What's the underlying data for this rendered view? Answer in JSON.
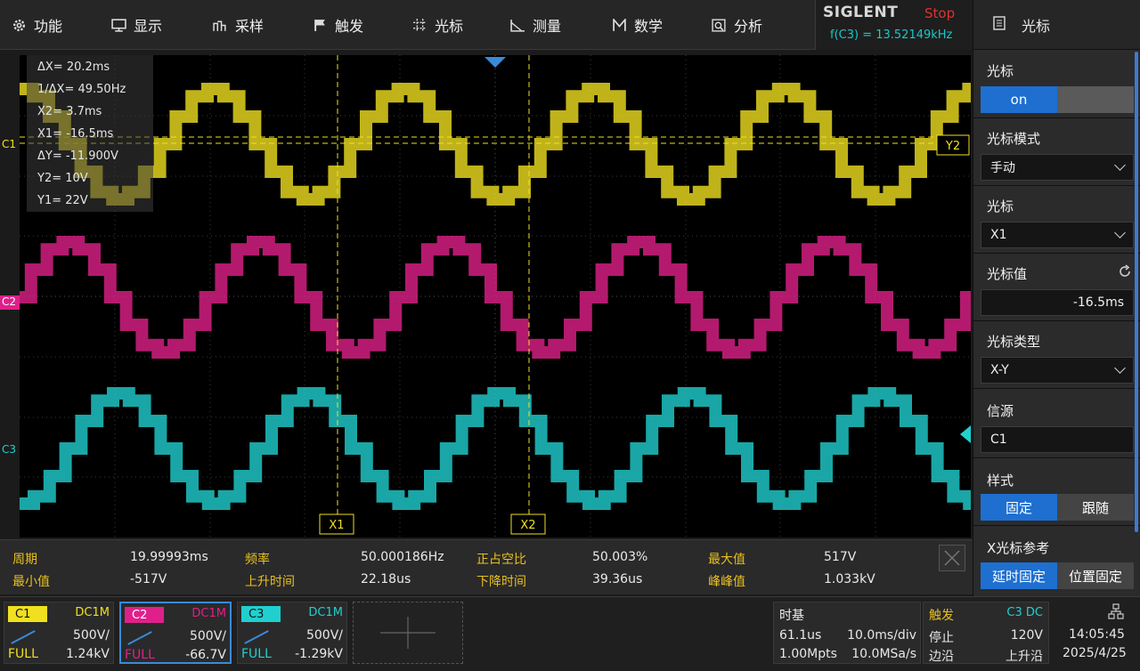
{
  "menu": [
    {
      "label": "功能",
      "icon": "gear-icon"
    },
    {
      "label": "显示",
      "icon": "monitor-icon"
    },
    {
      "label": "采样",
      "icon": "sample-icon"
    },
    {
      "label": "触发",
      "icon": "flag-icon"
    },
    {
      "label": "光标",
      "icon": "cursor-icon"
    },
    {
      "label": "测量",
      "icon": "ruler-icon"
    },
    {
      "label": "数学",
      "icon": "math-icon"
    },
    {
      "label": "分析",
      "icon": "analyze-icon"
    }
  ],
  "brand": {
    "logo": "SIGLENT",
    "status": "Stop",
    "freq": "f(C3) = 13.52149kHz"
  },
  "panel": {
    "title": "光标",
    "cursor_label": "光标",
    "cursor_on": "on",
    "mode_label": "光标模式",
    "mode_value": "手动",
    "cursor_sel_label": "光标",
    "cursor_sel_value": "X1",
    "value_label": "光标值",
    "value_value": "-16.5ms",
    "type_label": "光标类型",
    "type_value": "X-Y",
    "source_label": "信源",
    "source_value": "C1",
    "style_label": "样式",
    "style_a": "固定",
    "style_b": "跟随",
    "xref_label": "X光标参考",
    "xref_a": "延时固定",
    "xref_b": "位置固定"
  },
  "readout": [
    "ΔX= 20.2ms",
    "1/ΔX= 49.50Hz",
    "X2= 3.7ms",
    "X1= -16.5ms",
    "ΔY= -11.900V",
    "Y2= 10V",
    "Y1= 22V"
  ],
  "markers": {
    "x1": "X1",
    "x2": "X2",
    "y2": "Y2",
    "c1": "C1",
    "c2": "C2",
    "c3": "C3"
  },
  "measure": {
    "period_l": "周期",
    "period_v": "19.99993ms",
    "freq_l": "频率",
    "freq_v": "50.000186Hz",
    "duty_l": "正占空比",
    "duty_v": "50.003%",
    "max_l": "最大值",
    "max_v": "517V",
    "min_l": "最小值",
    "min_v": "-517V",
    "rise_l": "上升时间",
    "rise_v": "22.18us",
    "fall_l": "下降时间",
    "fall_v": "39.36us",
    "pp_l": "峰峰值",
    "pp_v": "1.033kV"
  },
  "channels": [
    {
      "name": "C1",
      "coupling": "DC1M",
      "scale": "500V/",
      "bw": "FULL",
      "offset": "1.24kV",
      "color": "#f0e020"
    },
    {
      "name": "C2",
      "coupling": "DC1M",
      "scale": "500V/",
      "bw": "FULL",
      "offset": "-66.7V",
      "color": "#e0208a"
    },
    {
      "name": "C3",
      "coupling": "DC1M",
      "scale": "500V/",
      "bw": "FULL",
      "offset": "-1.29kV",
      "color": "#20d0d0"
    }
  ],
  "timebase": {
    "label": "时基",
    "delay": "61.1us",
    "div": "10.0ms/div",
    "mpts": "1.00Mpts",
    "rate": "10.0MSa/s"
  },
  "trigger": {
    "label": "触发",
    "src": "C3 DC",
    "mode": "停止",
    "level": "120V",
    "type": "边沿",
    "slope": "上升沿"
  },
  "clock": {
    "time": "14:05:45",
    "date": "2025/4/25"
  },
  "colors": {
    "c1": "#f0e020",
    "c2": "#e0208a",
    "c3": "#20d0d0",
    "accent": "#1e6fd0",
    "measure_label": "#e8c020"
  }
}
